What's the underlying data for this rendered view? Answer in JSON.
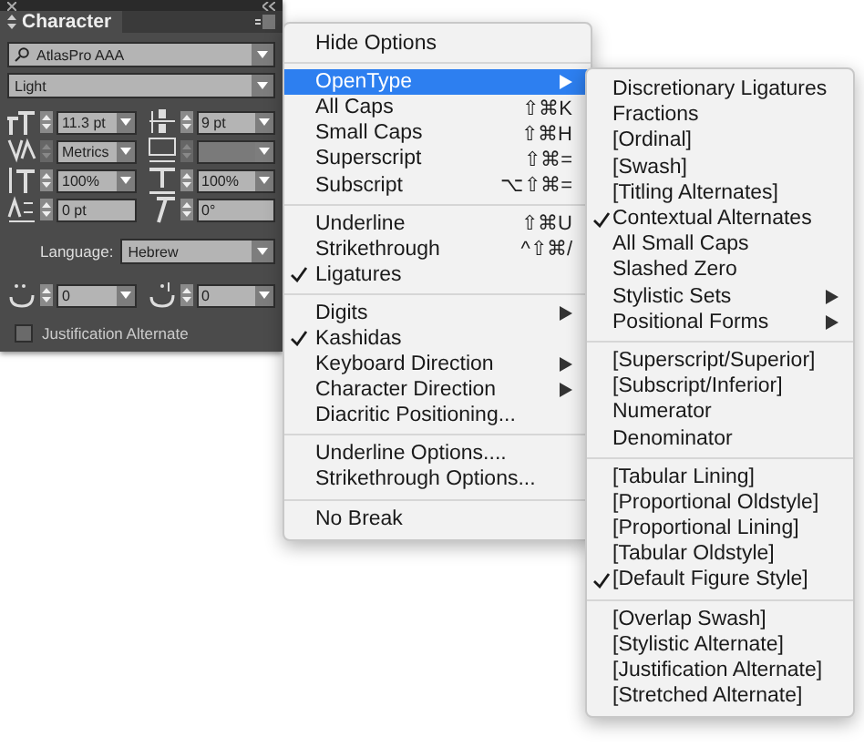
{
  "panel": {
    "title": "Character",
    "font_family": "AtlasPro AAA",
    "font_style": "Light",
    "fields": [
      {
        "kind": "size",
        "value": "11.3 pt",
        "dropdown": true,
        "disabled": false
      },
      {
        "kind": "leading",
        "value": "9 pt",
        "dropdown": true,
        "disabled": false
      },
      {
        "kind": "kerning",
        "value": "Metrics",
        "dropdown": true,
        "disabled": true
      },
      {
        "kind": "tracking",
        "dropdown": true,
        "disabled": true
      },
      {
        "kind": "vscale",
        "value": "100%",
        "dropdown": true,
        "disabled": false
      },
      {
        "kind": "hscale",
        "value": "100%",
        "dropdown": true,
        "disabled": false
      },
      {
        "kind": "baseline",
        "value": "0 pt",
        "dropdown": false,
        "disabled": false
      },
      {
        "kind": "skew",
        "value": "0°",
        "dropdown": false,
        "disabled": false
      }
    ],
    "language_label": "Language:",
    "language": "Hebrew",
    "arabic_fields": [
      {
        "kind": "kashida",
        "value": "0",
        "dropdown": true,
        "disabled": false
      },
      {
        "kind": "diacritic",
        "value": "0",
        "dropdown": true,
        "disabled": false
      }
    ],
    "checkbox": {
      "label": "Justification Alternate",
      "checked": false
    }
  },
  "menu": {
    "sections": [
      {
        "items": [
          {
            "label": "Hide Options",
            "checked": false,
            "submenu": false,
            "selected": false
          }
        ]
      },
      {
        "items": [
          {
            "label": "OpenType",
            "checked": false,
            "submenu": true,
            "selected": true
          },
          {
            "label": "All Caps",
            "shortcut": "⇧⌘K",
            "checked": false,
            "submenu": false,
            "selected": false
          },
          {
            "label": "Small Caps",
            "shortcut": "⇧⌘H",
            "checked": false,
            "submenu": false,
            "selected": false
          },
          {
            "label": "Superscript",
            "shortcut": "⇧⌘=",
            "checked": false,
            "submenu": false,
            "selected": false
          },
          {
            "label": "Subscript",
            "shortcut": "⌥⇧⌘=",
            "checked": false,
            "submenu": false,
            "selected": false
          }
        ]
      },
      {
        "items": [
          {
            "label": "Underline",
            "shortcut": "⇧⌘U",
            "checked": false,
            "submenu": false,
            "selected": false
          },
          {
            "label": "Strikethrough",
            "shortcut": "^⇧⌘/",
            "checked": false,
            "submenu": false,
            "selected": false
          },
          {
            "label": "Ligatures",
            "checked": true,
            "submenu": false,
            "selected": false
          }
        ]
      },
      {
        "items": [
          {
            "label": "Digits",
            "checked": false,
            "submenu": true,
            "selected": false
          },
          {
            "label": "Kashidas",
            "checked": true,
            "submenu": false,
            "selected": false
          },
          {
            "label": "Keyboard Direction",
            "checked": false,
            "submenu": true,
            "selected": false
          },
          {
            "label": "Character Direction",
            "checked": false,
            "submenu": true,
            "selected": false
          },
          {
            "label": "Diacritic Positioning...",
            "checked": false,
            "submenu": false,
            "selected": false
          }
        ]
      },
      {
        "items": [
          {
            "label": "Underline Options....",
            "checked": false,
            "submenu": false,
            "selected": false
          },
          {
            "label": "Strikethrough Options...",
            "checked": false,
            "submenu": false,
            "selected": false
          }
        ]
      },
      {
        "items": [
          {
            "label": "No Break",
            "checked": false,
            "submenu": false,
            "selected": false
          }
        ]
      }
    ]
  },
  "submenu": {
    "sections": [
      {
        "items": [
          {
            "label": "Discretionary Ligatures",
            "checked": false,
            "submenu": false
          },
          {
            "label": "Fractions",
            "checked": false,
            "submenu": false
          },
          {
            "label": "[Ordinal]",
            "checked": false,
            "submenu": false
          },
          {
            "label": "[Swash]",
            "checked": false,
            "submenu": false
          },
          {
            "label": "[Titling Alternates]",
            "checked": false,
            "submenu": false
          },
          {
            "label": "Contextual Alternates",
            "checked": true,
            "submenu": false
          },
          {
            "label": "All Small Caps",
            "checked": false,
            "submenu": false
          },
          {
            "label": "Slashed Zero",
            "checked": false,
            "submenu": false
          },
          {
            "label": "Stylistic Sets",
            "checked": false,
            "submenu": true
          },
          {
            "label": "Positional Forms",
            "checked": false,
            "submenu": true
          }
        ]
      },
      {
        "items": [
          {
            "label": "[Superscript/Superior]",
            "checked": false,
            "submenu": false
          },
          {
            "label": "[Subscript/Inferior]",
            "checked": false,
            "submenu": false
          },
          {
            "label": "Numerator",
            "checked": false,
            "submenu": false
          },
          {
            "label": "Denominator",
            "checked": false,
            "submenu": false
          }
        ]
      },
      {
        "items": [
          {
            "label": "[Tabular Lining]",
            "checked": false,
            "submenu": false
          },
          {
            "label": "[Proportional Oldstyle]",
            "checked": false,
            "submenu": false
          },
          {
            "label": "[Proportional Lining]",
            "checked": false,
            "submenu": false
          },
          {
            "label": "[Tabular Oldstyle]",
            "checked": false,
            "submenu": false
          },
          {
            "label": "[Default Figure Style]",
            "checked": true,
            "submenu": false
          }
        ]
      },
      {
        "items": [
          {
            "label": "[Overlap Swash]",
            "checked": false,
            "submenu": false
          },
          {
            "label": "[Stylistic Alternate]",
            "checked": false,
            "submenu": false
          },
          {
            "label": "[Justification Alternate]",
            "checked": false,
            "submenu": false
          },
          {
            "label": "[Stretched Alternate]",
            "checked": false,
            "submenu": false
          }
        ]
      }
    ]
  }
}
